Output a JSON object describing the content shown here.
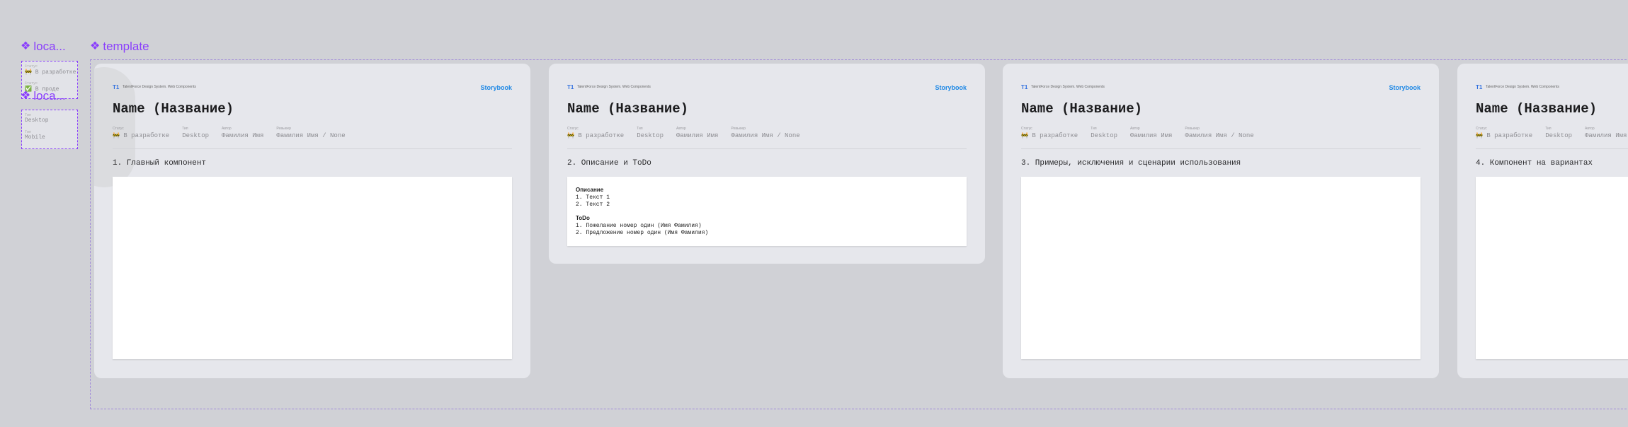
{
  "components": {
    "localization_label": "loca...",
    "template_label": "template"
  },
  "variants_status": {
    "label_top": "Статус",
    "in_progress": "В разработке",
    "label_mid": "Статус",
    "done": "В проде"
  },
  "variants_type": {
    "label_top": "Тип",
    "desktop": "Desktop",
    "label_mid": "Тип",
    "mobile": "Mobile"
  },
  "header": {
    "logo": "T1",
    "subtitle": "TalentForce Design System. Web Components",
    "storybook": "Storybook"
  },
  "title": "Name (Название)",
  "meta": {
    "status_key": "Статус",
    "status_value": "В разработке",
    "type_key": "Тип",
    "type_value": "Desktop",
    "owner_key": "Автор",
    "owner_value": "Фамилия Имя",
    "reviewer_key": "Ревьюер",
    "reviewer_value": "Фамилия Имя / None"
  },
  "cards": [
    {
      "section": "1. Главный компонент"
    },
    {
      "section": "2. Описание и ToDo"
    },
    {
      "section": "3. Примеры, исключения и сценарии использования"
    },
    {
      "section": "4. Компонент на вариантах"
    }
  ],
  "description": {
    "heading": "Описание",
    "items": [
      "1. Текст 1",
      "2. Текст 2"
    ],
    "todo_heading": "ToDo",
    "todo_items": [
      "1. Пожелание номер один (Имя Фамилия)",
      "2. Предложение номер один (Имя Фамилия)"
    ]
  },
  "colors": {
    "accent_purple": "#8a3ffc",
    "storybook_blue": "#1e88e5",
    "t1_blue": "#2f6fdf",
    "canvas": "#d0d1d6",
    "card": "#e6e7ec"
  }
}
